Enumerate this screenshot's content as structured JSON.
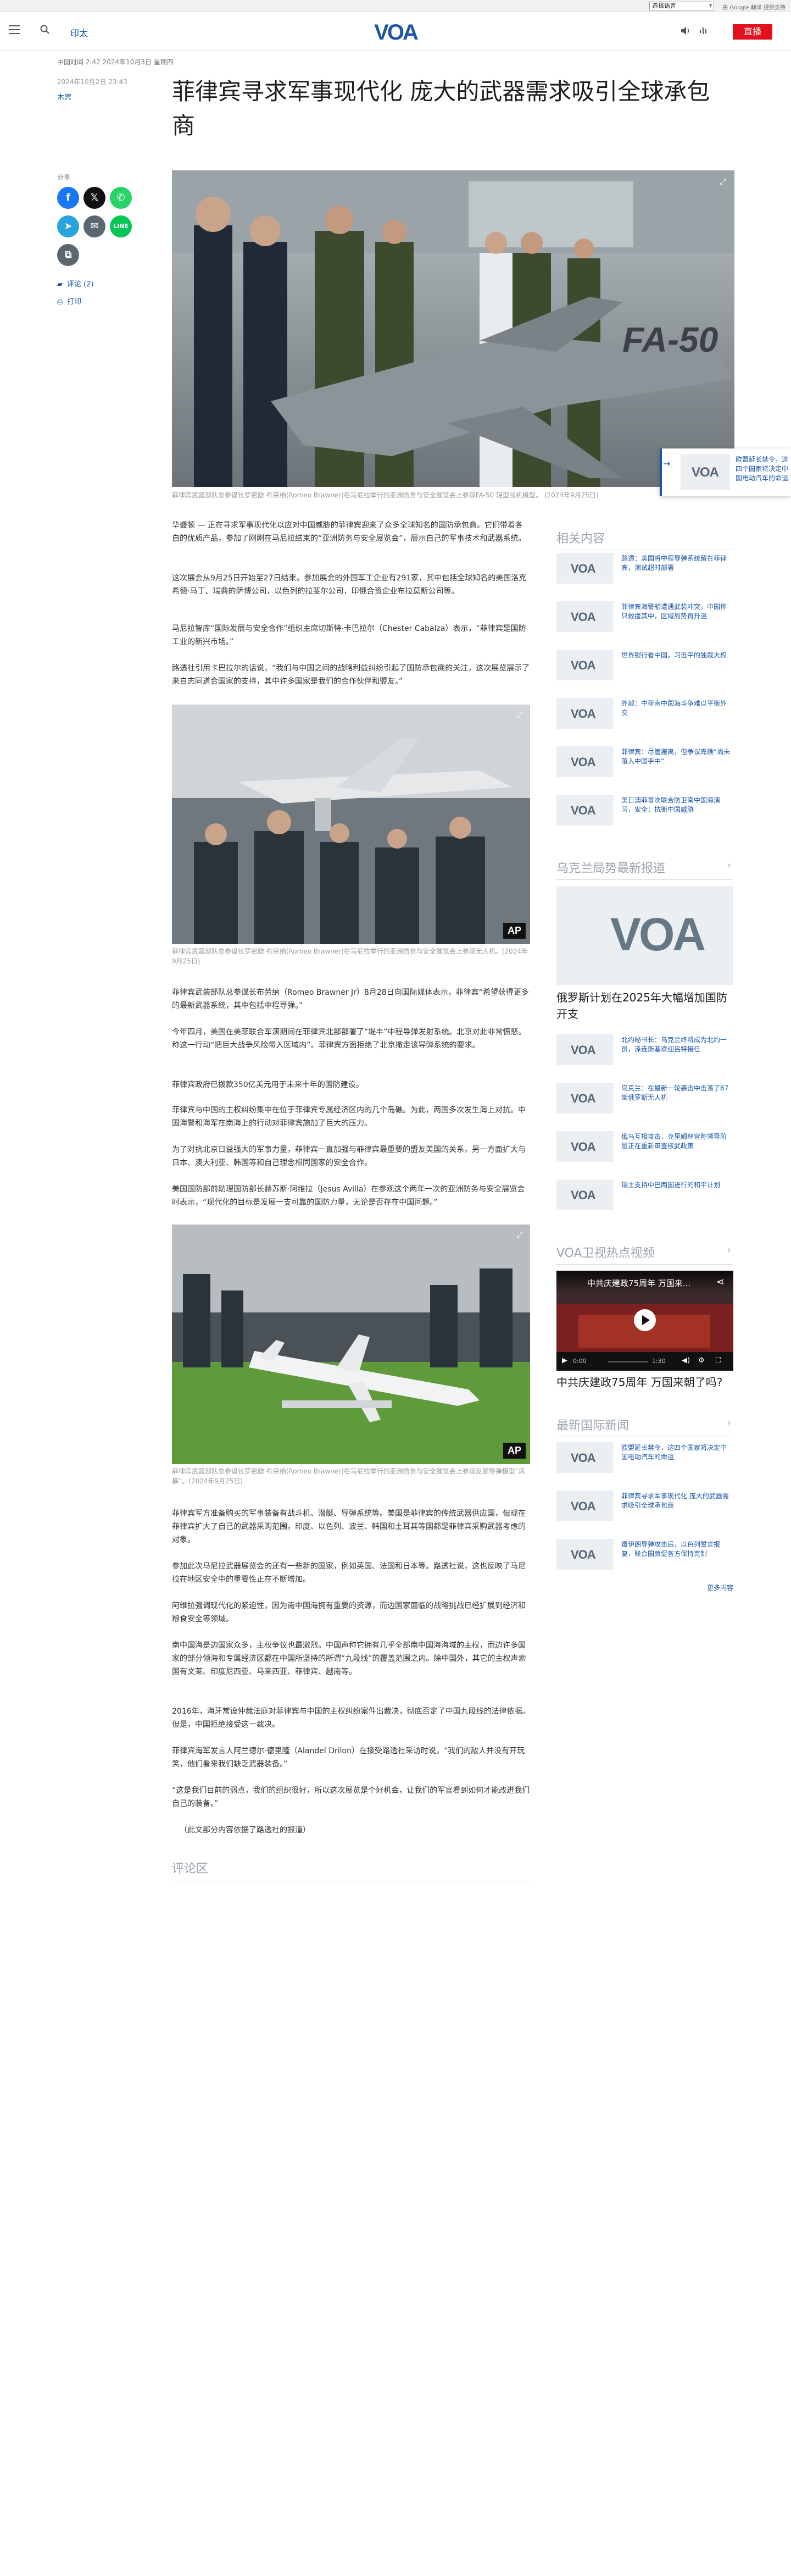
{
  "topbar": {
    "language_select": "选择语言",
    "translate_credit": "由 Google 翻译 提供支持"
  },
  "header": {
    "link": "印太",
    "live_button": "直播",
    "logo_text": "VOA"
  },
  "article": {
    "date_line": "中国时间 2:42 2024年10月3日 星期四",
    "pub_date": "2024年10月2日 23:43",
    "author": "木宾",
    "title": "菲律宾寻求军事现代化 庞大的武器需求吸引全球承包商",
    "share_label": "分享",
    "comments_link": "评论 (2)",
    "print_link": "打印",
    "main_caption": "菲律宾武器部队总参谋长罗密欧·布劳纳(Romeo Brawner)在马尼拉举行的亚洲防务与安全展览会上参观FA-50 轻型战机模型。 (2024年9月25日)",
    "inline_caption_1": "菲律宾武器部队总参谋长罗密欧·布劳纳(Romeo Brawner)在马尼拉举行的亚洲防务与安全展览会上参观无人机。(2024年9月25日)",
    "inline_caption_2": "菲律宾武器部队总参谋长罗密欧·布劳纳(Romeo Brawner)在马尼拉举行的亚洲防务与安全展览会上参观反舰导弹模型“风暴”。(2024年9月25日)",
    "paragraphs_a": [
      "华盛顿 — 正在寻求军事现代化以应对中国威胁的菲律宾迎来了众多全球知名的国防承包商。它们带着各自的优质产品，参加了刚刚在马尼拉结束的“亚洲防务与安全展览会”，展示自己的军事技术和武器系统。",
      "这次展会从9月25日开始至27日结束。参加展会的外国军工企业有291家，其中包括全球知名的美国洛克希德·马丁、瑞典的萨博公司，以色列的拉斐尔公司，印俄合资企业布拉莫斯公司等。",
      "马尼拉智库“国际发展与安全合作”组织主席切斯特·卡巴拉尔（Chester Cabalza）表示，“菲律宾是国防工业的新兴市场。”",
      "路透社引用卡巴拉尔的话说，“我们与中国之间的战略利益纠纷引起了国防承包商的关注，这次展览展示了来自志同道合国家的支持，其中许多国家是我们的合作伙伴和盟友。”"
    ],
    "paragraphs_b": [
      "菲律宾武装部队总参谋长布劳纳（Romeo Brawner Jr）8月28日向国际媒体表示，菲律宾“希望获得更多的最新武器系统，其中包括中程导弹。”",
      "今年四月，美国在美菲联合军演期间在菲律宾北部部署了“堤丰”中程导弹发射系统。北京对此非常愤怒。称这一行动“把巨大战争风险带入区域内”。菲律宾方面拒绝了北京撤走该导弹系统的要求。",
      "菲律宾政府已拨款350亿美元用于未来十年的国防建设。",
      "菲律宾与中国的主权纠纷集中在位于菲律宾专属经济区内的几个岛礁。为此，两国多次发生海上对抗。中国海警和海军在南海上的行动对菲律宾施加了巨大的压力。",
      "为了对抗北京日益强大的军事力量，菲律宾一直加强与菲律宾最重要的盟友美国的关系，另一方面扩大与日本、澳大利亚、韩国等和自己理念相同国家的安全合作。",
      "美国国防部前助理国防部长赫苏斯·阿维拉（Jesus Avilla）在参观这个两年一次的亚洲防务与安全展览会时表示，“现代化的目标是发展一支可靠的国防力量，无论是否存在中国问题。”"
    ],
    "paragraphs_c": [
      "菲律宾军方准备购买的军事装备有战斗机、潜艇、导弹系统等。美国是菲律宾的传统武器供应国，但现在菲律宾扩大了自己的武器采购范围，印度、以色列、波兰、韩国和土耳其等国都是菲律宾采购武器考虑的对象。",
      "参加此次马尼拉武器展览会的还有一些新的国家，例如英国、法国和日本等。路透社说，这也反映了马尼拉在地区安全中的重要性正在不断增加。",
      "阿维拉强调现代化的紧迫性，因为南中国海拥有重要的资源，而边国家面临的战略挑战已经扩展到经济和粮食安全等领域。",
      "南中国海是边国家众多，主权争议也最激烈。中国声称它拥有几乎全部南中国海海域的主权，而边许多国家的部分领海和专属经济区都在中国所坚持的所谓“九段线”的覆盖范围之内。除中国外，其它的主权声索国有文莱、印度尼西亚、马来西亚、菲律宾、越南等。",
      "2016年，海牙常设仲裁法庭对菲律宾与中国的主权纠纷案件出裁决，彻底否定了中国九段线的法律依据。但是，中国拒绝接受这一裁决。",
      "菲律宾海军发言人阿兰德尔·德里隆（Alandel Drilon）在接受路透社采访时说，“我们的敌人并没有开玩笑，他们看来我们缺乏武器装备。”",
      "“这是我们目前的弱点，我们的组织很好，所以这次展览是个好机会，让我们的军官看到如何才能改进我们自己的装备。”",
      "（此文部分内容依据了路透社的报道）"
    ],
    "comments_title": "评论区"
  },
  "sidebar": {
    "related_title": "相关内容",
    "related": [
      "路透：美国将中程导弹系统留在菲律宾，测试超时部署",
      "菲律宾海警船遭遇武装冲突，中国称只救援其中，区域局势再升温",
      "世界银行看中国，习近平的独裁大权",
      "外部：中菲南中国海斗争难以平衡外交",
      "菲律宾：尽管搬离，但争议岛礁“尚未落入中国手中”",
      "美日澳菲首次联合防卫南中国海演习，安全：抗衡中国威胁"
    ],
    "ukraine_title": "乌克兰局势最新报道",
    "ukraine_headline": "俄罗斯计划在2025年大幅增加国防开支",
    "ukraine_items": [
      "北约秘书长：乌克兰终将成为北约一员，泽连斯基欢迎吕特接任",
      "乌克兰：在最新一轮袭击中击落了67架俄罗斯无人机",
      "俄乌互相攻击，克里姆林宫称领导阶层正在重新审查核武政策",
      "瑞士支持中巴两国进行的和平计划"
    ],
    "video_title": "VOA卫视热点视频",
    "video_overlay_title": "中共庆建政75周年 万国来...",
    "video_current": "0:00",
    "video_duration": "1:30",
    "video_headline": "中共庆建政75周年 万国来朝了吗?",
    "intl_title": "最新国际新闻",
    "intl_items": [
      "欧盟延长禁令，这四个国家将决定中国电动汽车的命运",
      "菲律宾寻求军事现代化 庞大的武器需求吸引全球承包商",
      "遭伊朗导弹攻击后，以色列誓言报复，联合国敦促各方保持克制"
    ],
    "more_link": "更多内容"
  },
  "floating_card": {
    "text": "欧盟延长禁令，这四个国家将决定中国电动汽车的命运"
  },
  "colors": {
    "accent": "#1a56a8",
    "live_red": "#e1111d",
    "facebook": "#1877f2",
    "x": "#111111",
    "whatsapp": "#25d366",
    "telegram": "#2aa3e0",
    "email": "#5b6770",
    "line": "#06c755",
    "copy": "#5b6770"
  }
}
